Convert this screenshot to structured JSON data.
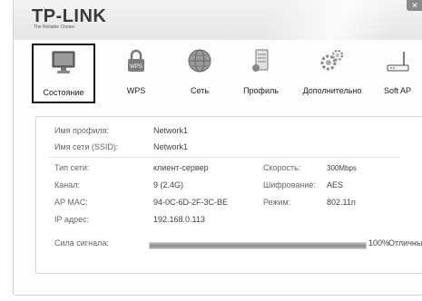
{
  "header": {
    "logo": "TP-LINK",
    "tagline": "The Reliable Choice",
    "close_glyph": "✕"
  },
  "toolbar": {
    "items": [
      {
        "label": "Состояние",
        "icon": "monitor-icon",
        "selected": true
      },
      {
        "label": "WPS",
        "icon": "wps-lock-icon"
      },
      {
        "label": "Сеть",
        "icon": "globe-icon"
      },
      {
        "label": "Профиль",
        "icon": "profile-icon"
      },
      {
        "label": "Дополнительно",
        "icon": "gears-icon"
      },
      {
        "label": "Soft AP",
        "icon": "router-icon"
      }
    ]
  },
  "status": {
    "profile_name_label": "Имя профиля:",
    "profile_name": "Network1",
    "ssid_label": "Имя сети (SSID):",
    "ssid": "Network1",
    "network_type_label": "Тип сети:",
    "network_type": "клиент-сервер",
    "speed_label": "Скорость:",
    "speed": "300Mbps",
    "channel_label": "Канал:",
    "channel": "9 (2.4G)",
    "encryption_label": "Шифрование:",
    "encryption": "AES",
    "ap_mac_label": "AP MAC:",
    "ap_mac": "94-0C-6D-2F-3C-BE",
    "mode_label": "Режим:",
    "mode": "802.11n",
    "ip_label": "IP адрес:",
    "ip": "192.168.0.113",
    "signal_label": "Сила сигнала:",
    "signal_percent": 100,
    "signal_percent_text": "100%",
    "signal_quality": "Отличный"
  }
}
